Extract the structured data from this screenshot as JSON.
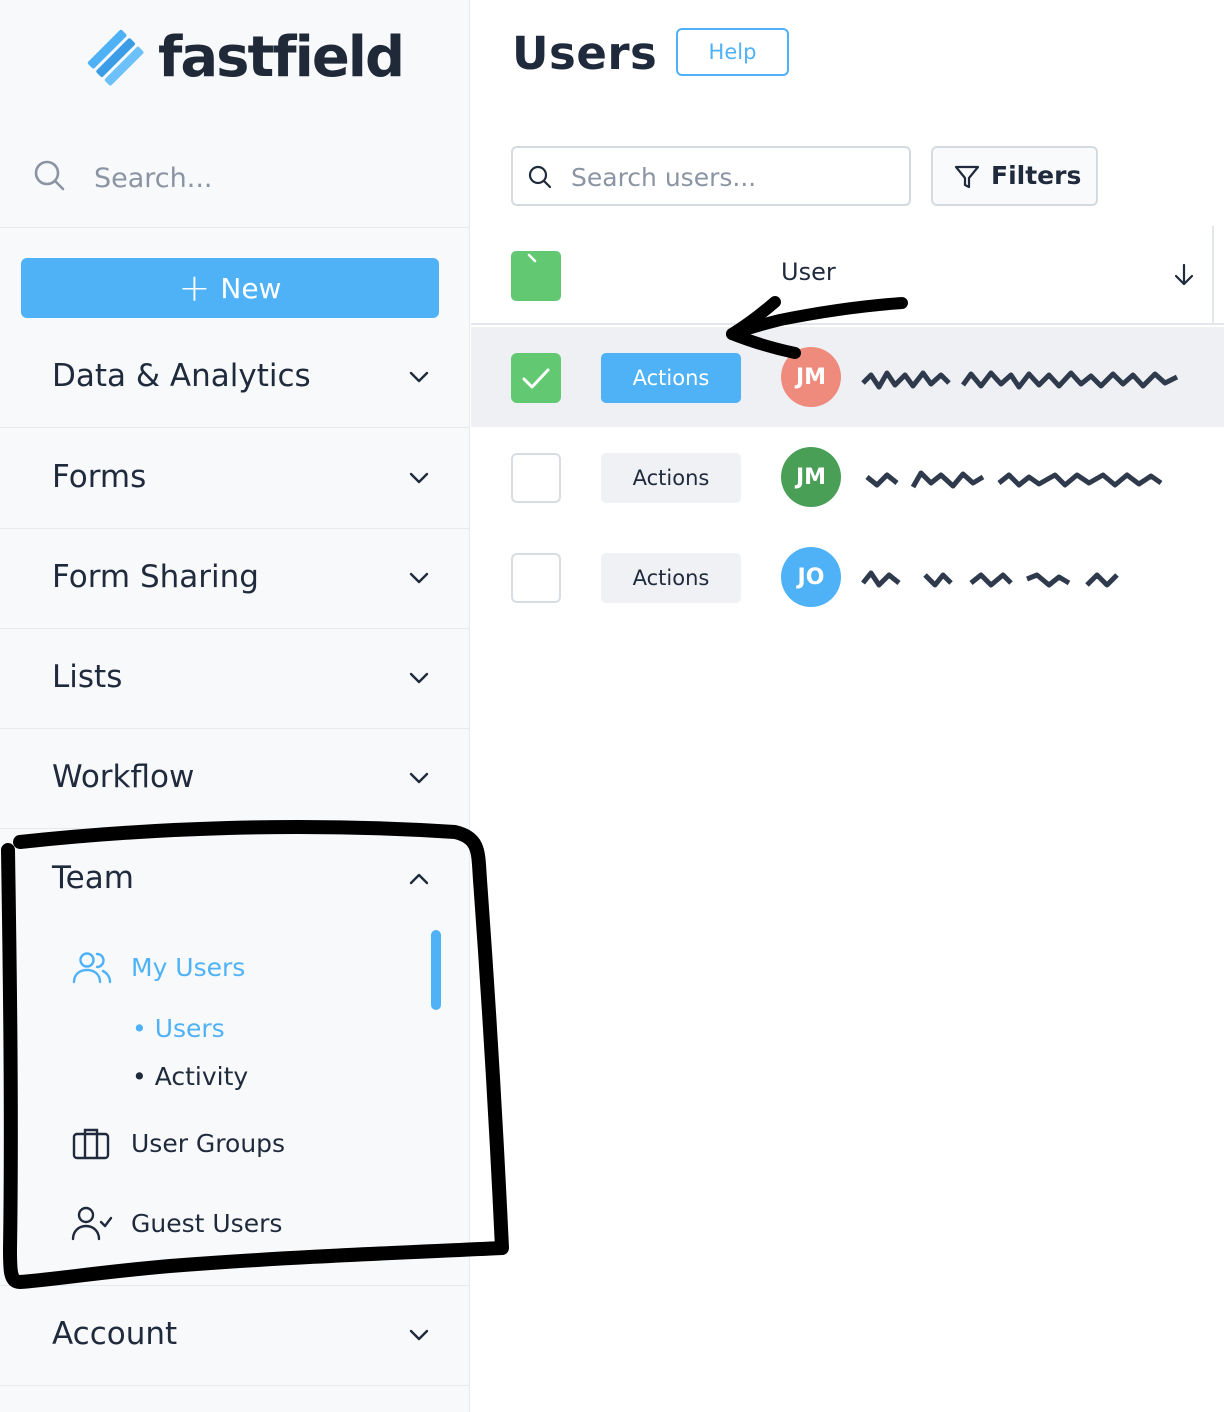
{
  "brand": {
    "name": "fastfield",
    "logo_color": "#4fb2f6"
  },
  "sidebar": {
    "search_placeholder": "Search...",
    "new_label": "New",
    "sections": [
      {
        "label": "Data & Analytics"
      },
      {
        "label": "Forms"
      },
      {
        "label": "Form Sharing"
      },
      {
        "label": "Lists"
      },
      {
        "label": "Workflow"
      }
    ],
    "team": {
      "label": "Team",
      "items": {
        "my_users": "My Users",
        "users": "Users",
        "activity": "Activity",
        "user_groups": "User Groups",
        "guest_users": "Guest Users"
      }
    },
    "account": {
      "label": "Account"
    }
  },
  "main": {
    "title": "Users",
    "help_label": "Help",
    "search_placeholder": "Search users...",
    "filters_label": "Filters",
    "table": {
      "column_user": "User",
      "rows": [
        {
          "initials": "JM",
          "avatar_color": "#ef8b7d",
          "actions_label": "Actions",
          "selected": true
        },
        {
          "initials": "JM",
          "avatar_color": "#4a9f57",
          "actions_label": "Actions",
          "selected": false
        },
        {
          "initials": "JO",
          "avatar_color": "#4fb2f6",
          "actions_label": "Actions",
          "selected": false
        }
      ]
    }
  },
  "colors": {
    "accent": "#4fb2f6",
    "success": "#62c972",
    "text": "#1f2a3c"
  }
}
